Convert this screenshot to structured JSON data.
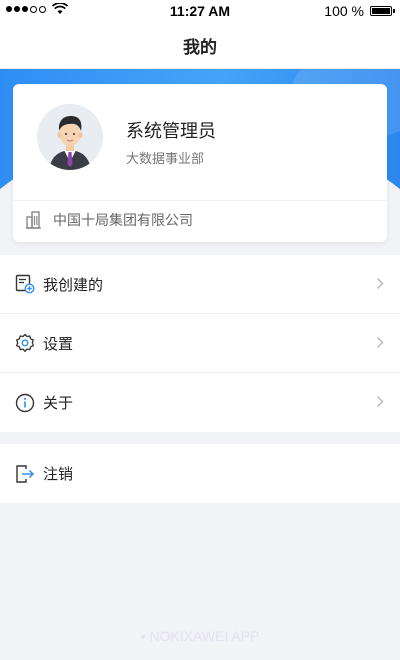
{
  "status_bar": {
    "time": "11:27 AM",
    "battery_text": "100 %",
    "battery_level": 1.0,
    "signal_bars_filled": 3,
    "signal_bars_total": 5
  },
  "nav": {
    "title": "我的"
  },
  "profile": {
    "name": "系统管理员",
    "department": "大数据事业部",
    "organization": "中国十局集团有限公司",
    "avatar_icon": "user-avatar-icon"
  },
  "menu": {
    "items": [
      {
        "label": "我创建的",
        "icon": "document-add-icon"
      },
      {
        "label": "设置",
        "icon": "gear-icon"
      },
      {
        "label": "关于",
        "icon": "info-icon"
      }
    ],
    "logout": {
      "label": "注销",
      "icon": "logout-icon"
    }
  },
  "watermark": "• NOKIXAWEI APP",
  "colors": {
    "accent": "#2f8ef5",
    "background": "#f2f3f7"
  }
}
